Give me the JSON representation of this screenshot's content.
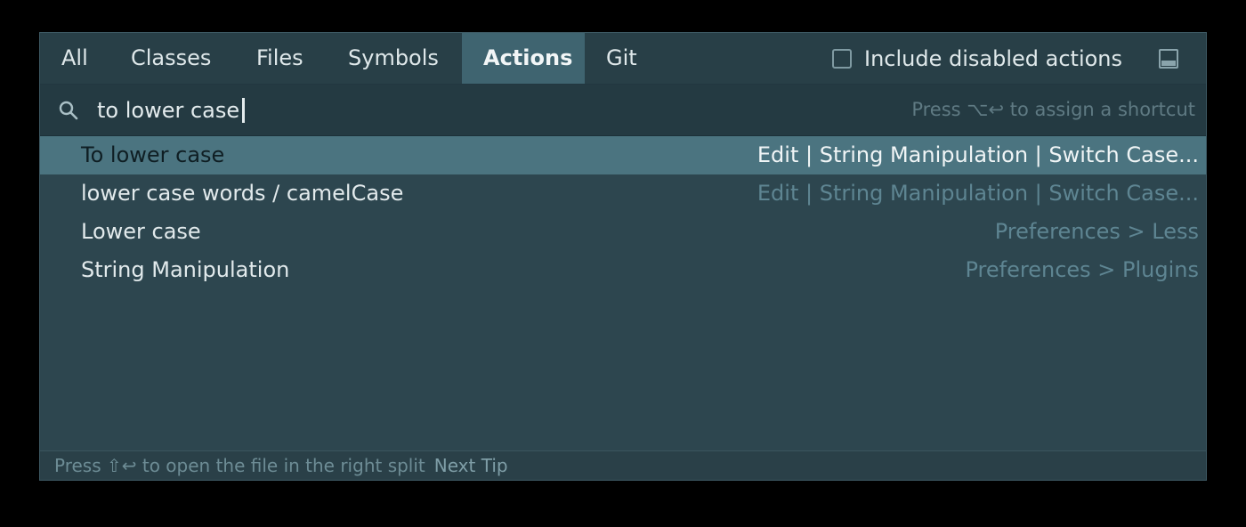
{
  "tabs": [
    {
      "label": "All",
      "active": false
    },
    {
      "label": "Classes",
      "active": false
    },
    {
      "label": "Files",
      "active": false
    },
    {
      "label": "Symbols",
      "active": false
    },
    {
      "label": "Actions",
      "active": true
    },
    {
      "label": "Git",
      "active": false
    }
  ],
  "options": {
    "include_disabled_label": "Include disabled actions",
    "include_disabled_checked": false,
    "layout_icon": "preview-panel-icon"
  },
  "search": {
    "icon": "search-icon",
    "value": "to lower case",
    "shortcut_hint": "Press ⌥↩ to assign a shortcut"
  },
  "results": [
    {
      "name": "To lower case",
      "path": "Edit | String Manipulation | Switch Case...",
      "selected": true
    },
    {
      "name": "lower case words / camelCase",
      "path": "Edit | String Manipulation | Switch Case...",
      "selected": false
    },
    {
      "name": "Lower case",
      "path": "Preferences > Less",
      "selected": false
    },
    {
      "name": "String Manipulation",
      "path": "Preferences > Plugins",
      "selected": false
    }
  ],
  "footer": {
    "hint": "Press ⇧↩ to open the file in the right split",
    "next_tip": "Next Tip"
  },
  "colors": {
    "background": "#2d464f",
    "tabbar": "#283f47",
    "active_tab": "#3f6470",
    "selected_row": "#4b7480",
    "secondary_text": "#5e8592"
  }
}
